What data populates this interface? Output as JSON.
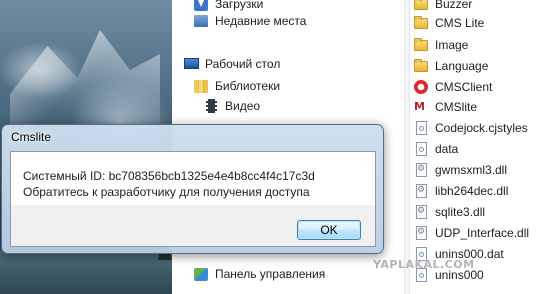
{
  "navigation": {
    "items": [
      {
        "label": "Загрузки",
        "icon": "download-icon"
      },
      {
        "label": "Недавние места",
        "icon": "recent-places-icon"
      },
      {
        "label": "Рабочий стол",
        "icon": "desktop-icon"
      },
      {
        "label": "Библиотеки",
        "icon": "libraries-icon"
      },
      {
        "label": "Видео",
        "icon": "video-icon"
      },
      {
        "label": "Панель управления",
        "icon": "control-panel-icon"
      }
    ]
  },
  "files": [
    {
      "name": "Buzzer",
      "icon": "folder-icon"
    },
    {
      "name": "CMS Lite",
      "icon": "folder-icon"
    },
    {
      "name": "Image",
      "icon": "folder-icon"
    },
    {
      "name": "Language",
      "icon": "folder-icon"
    },
    {
      "name": "CMSClient",
      "icon": "app-icon"
    },
    {
      "name": "CMSlite",
      "icon": "mfc-app-icon"
    },
    {
      "name": "Codejock.cjstyles",
      "icon": "file-icon"
    },
    {
      "name": "data",
      "icon": "file-icon"
    },
    {
      "name": "gwmsxml3.dll",
      "icon": "dll-icon"
    },
    {
      "name": "libh264dec.dll",
      "icon": "dll-icon"
    },
    {
      "name": "sqlite3.dll",
      "icon": "dll-icon"
    },
    {
      "name": "UDP_Interface.dll",
      "icon": "dll-icon"
    },
    {
      "name": "unins000.dat",
      "icon": "file-icon"
    },
    {
      "name": "unins000",
      "icon": "app-icon"
    }
  ],
  "dialog": {
    "title": "Cmslite",
    "message_line1": "Системный ID: bc708356bcb1325e4e4b8cc4f4c17c3d",
    "message_line2": "Обратитесь к разработчику для получения доступа",
    "ok_label": "OK"
  },
  "watermark": "YAPLAKAL.COM"
}
